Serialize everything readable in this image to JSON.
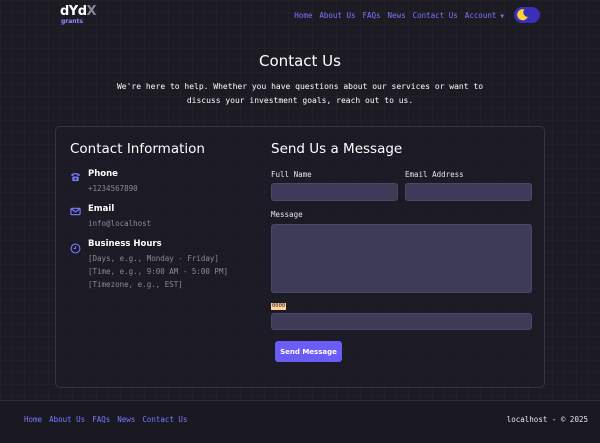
{
  "brand": {
    "main": "dYdX",
    "sub": "grants"
  },
  "nav": {
    "items": [
      "Home",
      "About Us",
      "FAQs",
      "News",
      "Contact Us"
    ],
    "account": "Account"
  },
  "page": {
    "title": "Contact Us",
    "intro": "We're here to help. Whether you have questions about our services or want to discuss your investment goals, reach out to us."
  },
  "contact_info": {
    "title": "Contact Information",
    "phone": {
      "label": "Phone",
      "value": "+1234567890"
    },
    "email": {
      "label": "Email",
      "value": "info@localhost"
    },
    "hours": {
      "label": "Business Hours",
      "lines": [
        "[Days, e.g., Monday - Friday]",
        "[Time, e.g., 9:00 AM - 5:00 PM]",
        "[Timezone, e.g., EST]"
      ]
    }
  },
  "form": {
    "title": "Send Us a Message",
    "full_name_label": "Full Name",
    "email_label": "Email Address",
    "message_label": "Message",
    "captcha_label": "0000",
    "submit_label": "Send Message"
  },
  "footer": {
    "links": [
      "Home",
      "About Us",
      "FAQs",
      "News",
      "Contact Us"
    ],
    "copyright": "localhost - © 2025"
  },
  "colors": {
    "background": "#1c1b24",
    "accent": "#7a78ff",
    "button": "#6b5cf6",
    "field": "#3d3b57"
  }
}
